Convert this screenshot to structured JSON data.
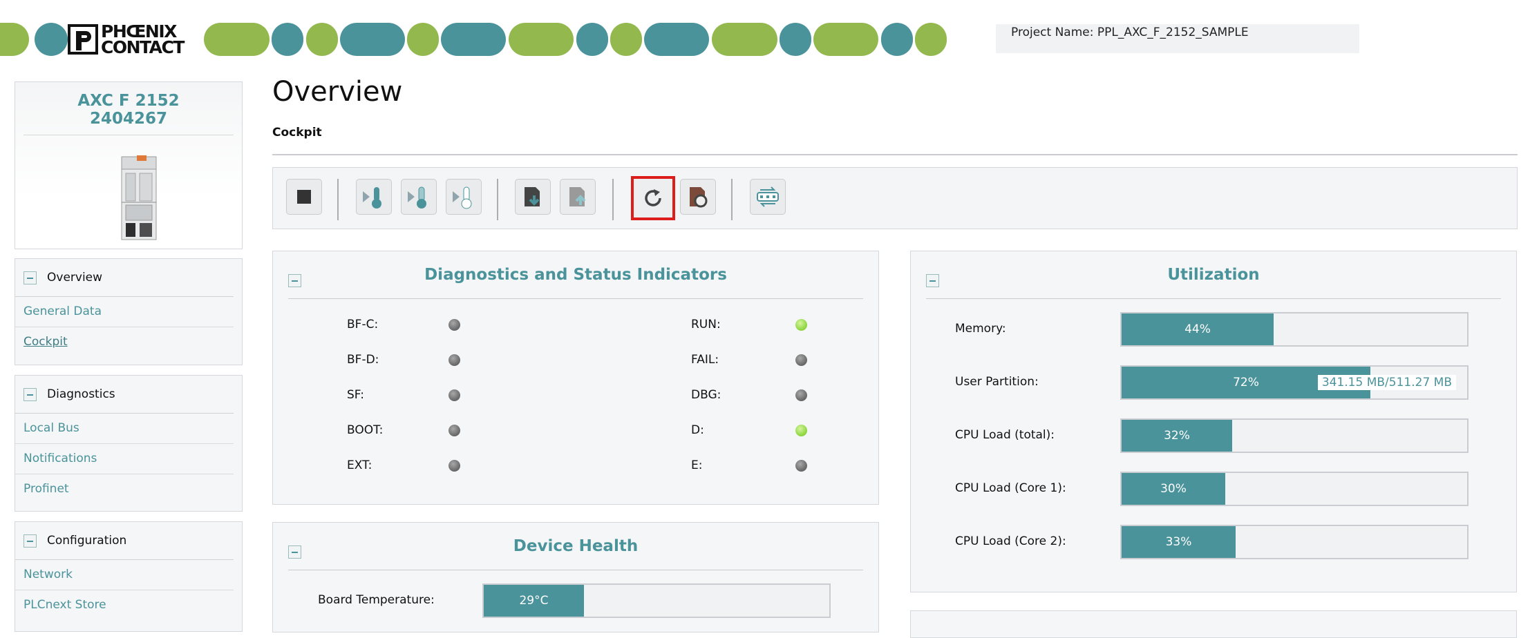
{
  "header": {
    "logo_line1": "PHŒNIX",
    "logo_line2": "CONTACT",
    "project_label": "Project Name: PPL_AXC_F_2152_SAMPLE"
  },
  "device": {
    "name": "AXC F 2152",
    "part_number": "2404267"
  },
  "nav": [
    {
      "section": "Overview",
      "items": [
        "General Data",
        "Cockpit"
      ]
    },
    {
      "section": "Diagnostics",
      "items": [
        "Local Bus",
        "Notifications",
        "Profinet"
      ]
    },
    {
      "section": "Configuration",
      "items": [
        "Network",
        "PLCnext Store"
      ]
    }
  ],
  "main": {
    "title": "Overview",
    "subtitle": "Cockpit"
  },
  "toolbar": {
    "icons": [
      "stop-icon",
      "cold-restart-icon",
      "warm-restart-icon",
      "hot-restart-icon",
      "sd-download-icon",
      "sd-upload-icon",
      "reboot-icon",
      "reset-icon",
      "network-icon"
    ],
    "selected": "reboot-icon"
  },
  "diagnostics": {
    "title": "Diagnostics and Status Indicators",
    "left": [
      {
        "label": "BF-C:",
        "state": "off"
      },
      {
        "label": "BF-D:",
        "state": "off"
      },
      {
        "label": "SF:",
        "state": "off"
      },
      {
        "label": "BOOT:",
        "state": "off"
      },
      {
        "label": "EXT:",
        "state": "off"
      }
    ],
    "right": [
      {
        "label": "RUN:",
        "state": "on"
      },
      {
        "label": "FAIL:",
        "state": "off"
      },
      {
        "label": "DBG:",
        "state": "off"
      },
      {
        "label": "D:",
        "state": "on"
      },
      {
        "label": "E:",
        "state": "off"
      }
    ]
  },
  "health": {
    "title": "Device Health",
    "board_temp_label": "Board Temperature:",
    "board_temp_value": "29°C",
    "board_temp_fraction": 0.29
  },
  "utilization": {
    "title": "Utilization",
    "rows": [
      {
        "label": "Memory:",
        "value": "44%",
        "percent": 44,
        "extra": ""
      },
      {
        "label": "User Partition:",
        "value": "72%",
        "percent": 72,
        "extra": "341.15 MB/511.27 MB"
      },
      {
        "label": "CPU Load (total):",
        "value": "32%",
        "percent": 32,
        "extra": ""
      },
      {
        "label": "CPU Load (Core 1):",
        "value": "30%",
        "percent": 30,
        "extra": ""
      },
      {
        "label": "CPU Load (Core 2):",
        "value": "33%",
        "percent": 33,
        "extra": ""
      }
    ]
  },
  "colors": {
    "accent": "#4a939b",
    "green": "#93b84d",
    "led_on": "#8ad43c",
    "led_off": "#777777",
    "highlight": "#dd1c1c"
  }
}
